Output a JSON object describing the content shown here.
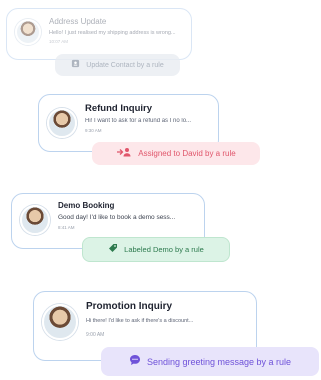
{
  "cards": [
    {
      "title": "Address Update",
      "message": "Hello! I just realised my shipping address is wrong...",
      "time": "10:07 AM",
      "pill": {
        "label": "Update Contact by a rule",
        "icon": "contact-card-icon",
        "color": "#9aa3b0"
      }
    },
    {
      "title": "Refund Inquiry",
      "message": "Hi! I want to ask for a refund as I no lo...",
      "time": "9:30 AM",
      "pill": {
        "label": "Assigned to David by a rule",
        "icon": "assign-user-icon",
        "color": "#e0566b"
      }
    },
    {
      "title": "Demo Booking",
      "message": "Good day! I'd like to book a demo sess...",
      "time": "8:41 AM",
      "pill": {
        "label": "Labeled Demo by a rule",
        "icon": "tag-icon",
        "color": "#2d7a4e"
      }
    },
    {
      "title": "Promotion Inquiry",
      "message": "Hi there! I'd like to ask if there's a discount...",
      "time": "9:00 AM",
      "pill": {
        "label": "Sending greeting message by a rule",
        "icon": "chat-bubble-icon",
        "color": "#6f52d9"
      }
    }
  ]
}
